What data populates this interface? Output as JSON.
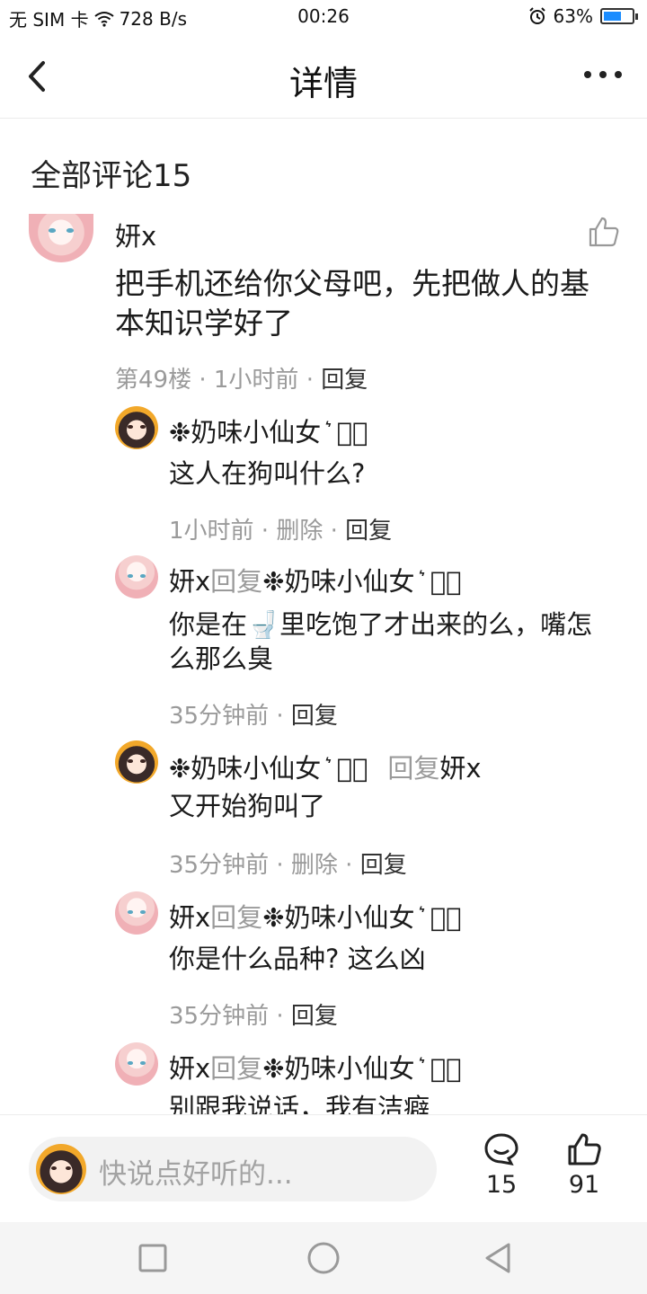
{
  "status": {
    "carrier": "无 SIM 卡",
    "speed": "728 B/s",
    "time": "00:26",
    "battery": "63%",
    "battery_level": 0.63,
    "accent": "#1a8cff"
  },
  "nav": {
    "title": "详情",
    "back_icon": "chevron-left-icon",
    "more_icon": "more-dots-icon"
  },
  "section": {
    "title": "全部评论15"
  },
  "main_comment": {
    "user": "妍x",
    "text": "把手机还给你父母吧，先把做人的基本知识学好了",
    "floor": "第49楼",
    "time": "1小时前",
    "reply": "回复"
  },
  "replies": [
    {
      "user": "❉奶味小仙女 ͛ ཻ͛",
      "reply_word": "",
      "target": "",
      "text": "这人在狗叫什么?",
      "time": "1小时前",
      "delete": "删除",
      "reply": "回复"
    },
    {
      "user": "妍x",
      "reply_word": "回复",
      "target": "❉奶味小仙女 ͛ ཻ͛",
      "text": "你是在🚽里吃饱了才出来的么，嘴怎么那么臭",
      "time": "35分钟前",
      "delete": "",
      "reply": "回复"
    },
    {
      "user": "❉奶味小仙女 ͛ ཻ͛",
      "reply_word": "回复",
      "target": "妍x",
      "text": "又开始狗叫了",
      "time": "35分钟前",
      "delete": "删除",
      "reply": "回复"
    },
    {
      "user": "妍x",
      "reply_word": "回复",
      "target": "❉奶味小仙女 ͛ ཻ͛",
      "text": "你是什么品种? 这么凶",
      "time": "35分钟前",
      "delete": "",
      "reply": "回复"
    },
    {
      "user": "妍x",
      "reply_word": "回复",
      "target": "❉奶味小仙女 ͛ ཻ͛",
      "text": "别跟我说话，我有洁癖"
    }
  ],
  "bottom": {
    "placeholder": "快说点好听的...",
    "comment_count": "15",
    "like_count": "91"
  }
}
